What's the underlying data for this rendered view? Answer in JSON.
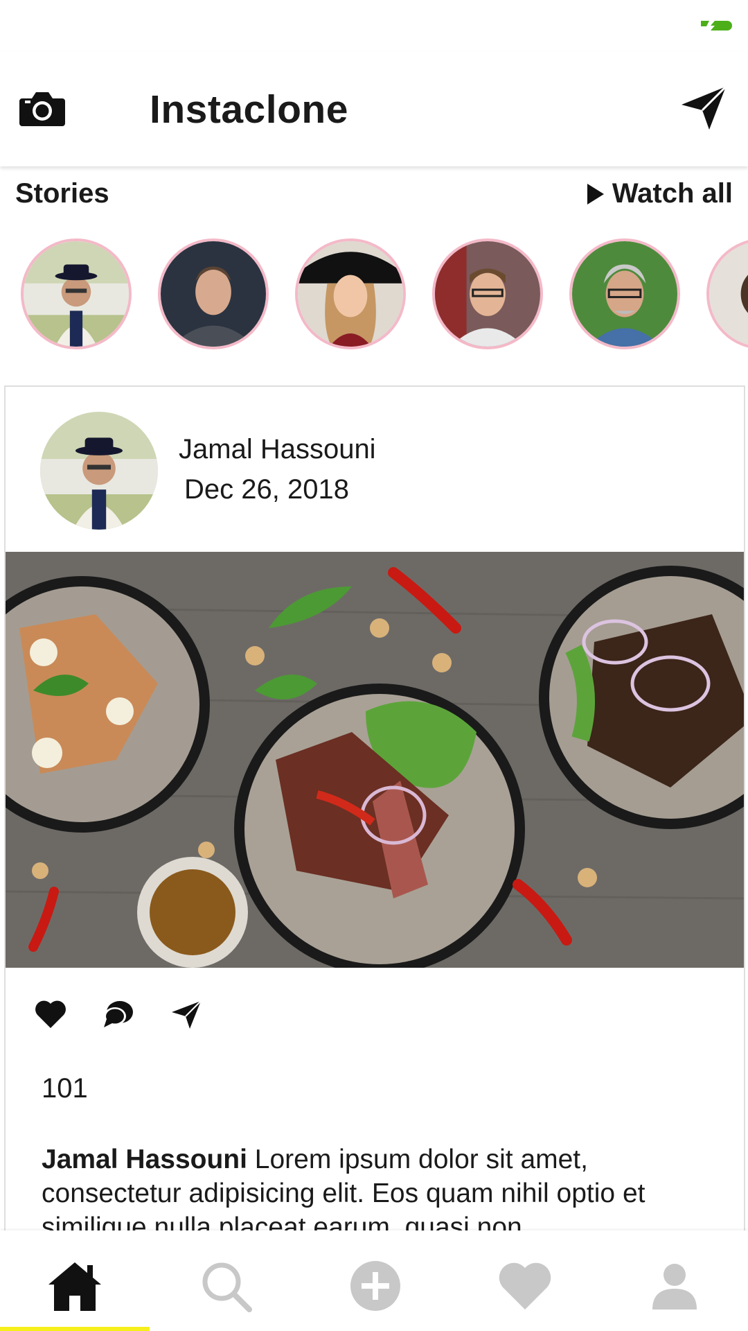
{
  "app": {
    "title": "Instaclone",
    "icons": {
      "camera": "camera-icon",
      "direct": "paper-plane-icon"
    }
  },
  "status_bar": {
    "indicator_icon": "battery-charging-icon",
    "indicator_color": "#4caf1a"
  },
  "stories": {
    "label": "Stories",
    "watch_all_label": "Watch all",
    "ring_color": "#f4b9c8",
    "items": [
      {
        "avatar": "man-with-black-hat"
      },
      {
        "avatar": "man-profile-dark"
      },
      {
        "avatar": "woman-with-black-hat"
      },
      {
        "avatar": "man-with-glasses"
      },
      {
        "avatar": "older-man-with-glasses"
      },
      {
        "avatar": "partial-avatar"
      }
    ]
  },
  "post": {
    "author": "Jamal Hassouni",
    "date": " Dec 26, 2018",
    "image_description_icon": "food-photo",
    "actions": [
      "heart-icon",
      "comment-icon",
      "paper-plane-icon"
    ],
    "likes": "101",
    "caption_author": "Jamal Hassouni",
    "caption_text": " Lorem ipsum dolor sit amet, consectetur adipisicing elit. Eos quam nihil optio et similique nulla placeat earum, quasi non"
  },
  "bottom_nav": {
    "items": [
      "home-icon",
      "search-icon",
      "add-icon",
      "heart-icon",
      "person-icon"
    ],
    "active_index": 0,
    "active_color": "#111111",
    "inactive_color": "#c8c8c8",
    "indicator_color": "#f6ef1c"
  }
}
